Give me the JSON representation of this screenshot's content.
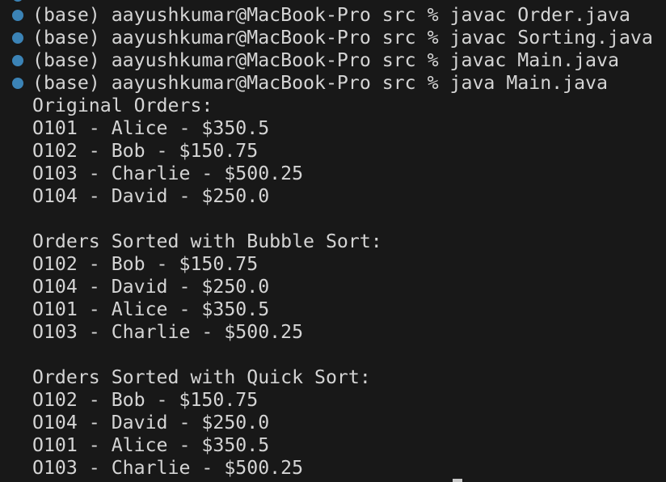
{
  "terminal": {
    "commands": [
      {
        "prompt": "(base) aayushkumar@MacBook-Pro src % ",
        "command": "javac Order.java"
      },
      {
        "prompt": "(base) aayushkumar@MacBook-Pro src % ",
        "command": "javac Sorting.java"
      },
      {
        "prompt": "(base) aayushkumar@MacBook-Pro src % ",
        "command": "javac Main.java"
      },
      {
        "prompt": "(base) aayushkumar@MacBook-Pro src % ",
        "command": "java Main.java"
      }
    ],
    "output": [
      "Original Orders:",
      "O101 - Alice - $350.5",
      "O102 - Bob - $150.75",
      "O103 - Charlie - $500.25",
      "O104 - David - $250.0",
      "",
      "Orders Sorted with Bubble Sort:",
      "O102 - Bob - $150.75",
      "O104 - David - $250.0",
      "O101 - Alice - $350.5",
      "O103 - Charlie - $500.25",
      "",
      "Orders Sorted with Quick Sort:",
      "O102 - Bob - $150.75",
      "O104 - David - $250.0",
      "O101 - Alice - $350.5",
      "O103 - Charlie - $500.25"
    ],
    "colors": {
      "background": "#181818",
      "text": "#d4d4d4",
      "status_dot": "#3b83b6"
    }
  }
}
